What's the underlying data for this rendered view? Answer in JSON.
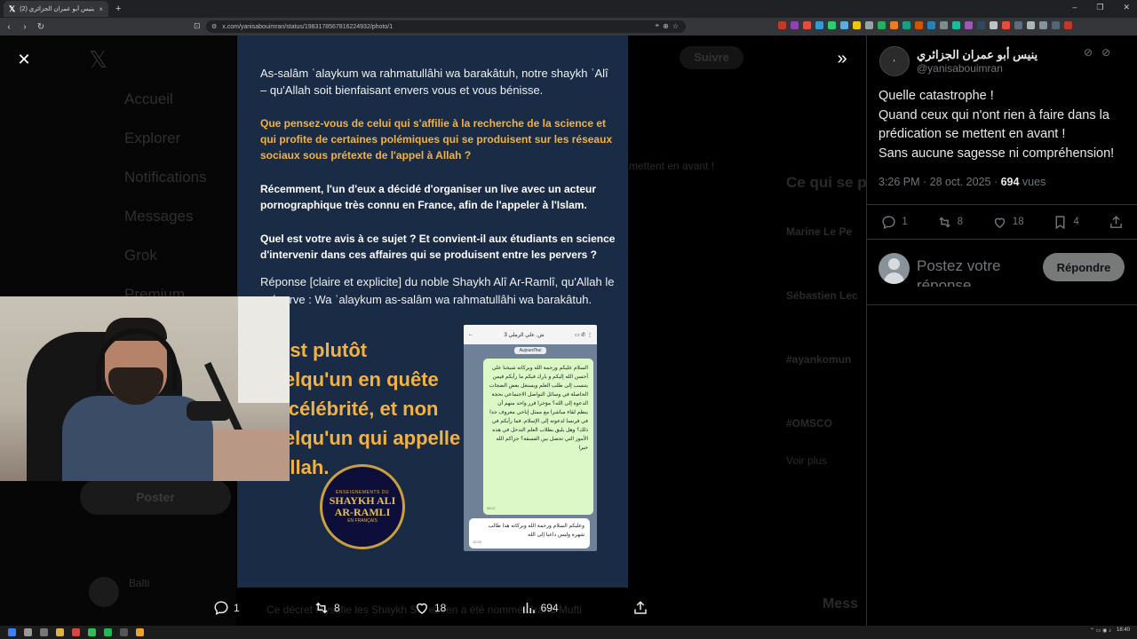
{
  "browser": {
    "tab_title": "(2) ينيس أبو عمران الجزائري",
    "tab_close": "×",
    "new_tab": "+",
    "url": "x.com/yanisabouimran/status/1983178567816224932/photo/1",
    "window_controls": [
      "–",
      "❐",
      "✕"
    ]
  },
  "background": {
    "nav": [
      "Accueil",
      "Explorer",
      "Notifications",
      "Messages",
      "Grok",
      "Premium"
    ],
    "post_btn": "Poster",
    "follow_btn": "Suivre",
    "trending_header": "Ce qui se p",
    "trending": [
      "Marine Le Pe",
      "Sébastien Lec",
      "#ayankomun",
      "#OMSCO",
      "Voir plus"
    ],
    "reply_user": "Balti",
    "ghost_line_1": "mettent en avant !",
    "ghost_line_2": "Ce décret mystifie les Shaykh S... ezeen a été nommé Grand Mufti",
    "message_label": "Mess"
  },
  "photo": {
    "intro": "As-salâm ʿalaykum wa rahmatullâhi wa barakâtuh, notre shaykh ʿAlî – qu'Allah soit bienfaisant envers vous et vous bénisse.",
    "question_1": "Que pensez-vous de celui qui s'affilie à la recherche de la science et qui profite de certaines polémiques qui se produisent sur les réseaux sociaux sous prétexte de l'appel à Allah ?",
    "question_2": "Récemment, l'un d'eux a décidé d'organiser un live avec un acteur pornographique très connu en France, afin de l'appeler à l'Islam.",
    "question_3": "Quel est votre avis à ce sujet ? Et convient-il aux étudiants en science d'intervenir dans ces affaires qui se produisent entre les pervers ?",
    "reponse": "Réponse [claire et explicite] du noble Shaykh Alî Ar-Ramlî, qu'Allah le préserve : Wa ʿalaykum as-salâm wa rahmatullâhi wa barakâtuh.",
    "big_answer": "C'est plutôt quelqu'un en quête de célébrité, et non quelqu'un qui appelle à Allah.",
    "seal": {
      "top": "ENSEIGNEMENTS DU",
      "name": "SHAYKH ALI AR-RAMLI",
      "bottom": "EN FRANÇAIS"
    },
    "phone": {
      "contact": "ش. علي الرملي 3",
      "date_chip": "Aujourd'hui",
      "message_out": "السلام عليكم ورحمة الله وبركاته شيخنا علي أحسن الله إليكم و بارك فيكم ما رأيكم فيمن ينتسب إلى طلب العلم ويستغل بعض الضجات الحاصلة في وسائل التواصل الاجتماعي بحجة الدعوة إلى الله؟ مؤخرا قرر واحد منهم أن ينظم لقاء مباشرا مع ممثل إباحي معروف جدا في فرنسا لدعوته إلى الإسلام. فما رأيكم في ذلك؟ وهل يليق بطلاب العلم التدخل في هذه الأمور التي تحصل بين الفسقة؟ جزاكم الله خيرا",
      "time_out": "08:57",
      "message_in": "وعليكم السلام ورحمة الله وبركاته هذا طالب شهرة وليس داعيا إلى الله",
      "time_in": "10:03"
    }
  },
  "photo_actions": {
    "replies": "1",
    "reposts": "8",
    "likes": "18",
    "views": "694"
  },
  "tweet": {
    "author_name": "ينيس أبو عمران الجزائري",
    "author_handle": "@yanisabouimran",
    "text_lines": [
      "Quelle catastrophe !",
      "Quand ceux qui n'ont rien à faire dans la prédication se mettent en avant !",
      "Sans aucune sagesse ni compréhension!"
    ],
    "time": "3:26 PM · 28 oct. 2025 · ",
    "views_count": "694",
    "views_label": " vues",
    "actions": {
      "replies": "1",
      "reposts": "8",
      "likes": "18",
      "bookmarks": "4"
    },
    "reply_placeholder": "Postez votre réponse",
    "reply_button": "Répondre"
  },
  "taskbar": {
    "time": "18:40"
  },
  "colors": {
    "accent_gold": "#f3b140",
    "photo_bg": "#1a2b45",
    "panel_bg": "#000000",
    "muted": "#71767b"
  }
}
